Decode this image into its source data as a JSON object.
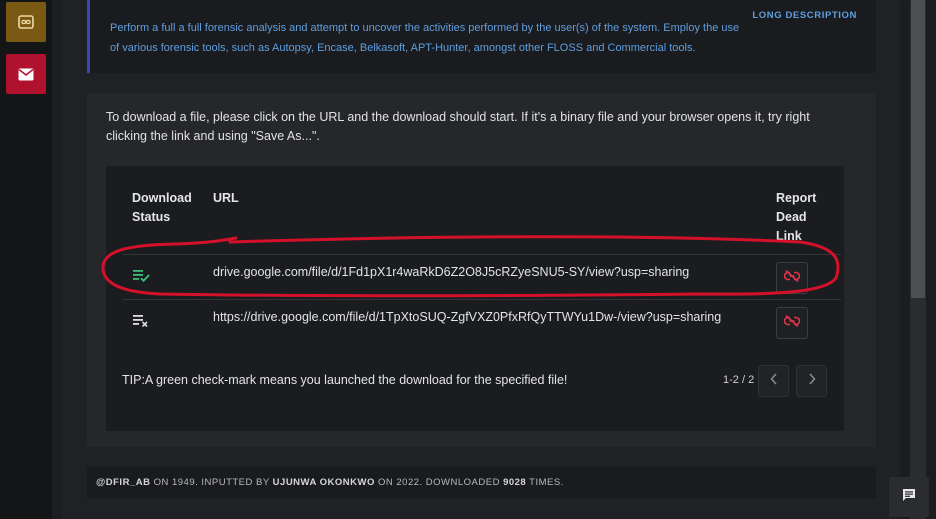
{
  "description": {
    "label": "LONG DESCRIPTION",
    "text": "Perform a full a full forensic analysis and attempt to uncover the activities performed by the user(s) of the system. Employ the use of various forensic tools, such as Autopsy, Encase, Belkasoft, APT-Hunter, amongst other FLOSS and Commercial tools."
  },
  "downloads": {
    "intro": "To download a file, please click on the URL and the download should start. If it's a binary file and your browser opens it, try right clicking the link and using \"Save As...\".",
    "headers": {
      "status_line1": "Download",
      "status_line2": "Status",
      "url": "URL",
      "report_line1": "Report",
      "report_line2": "Dead",
      "report_line3": "Link"
    },
    "rows": [
      {
        "status": "downloaded",
        "status_icon": "playlist-check-icon",
        "url": "drive.google.com/file/d/1Fd1pX1r4waRkD6Z2O8J5cRZyeSNU5-SY/view?usp=sharing"
      },
      {
        "status": "not-downloaded",
        "status_icon": "playlist-remove-icon",
        "url": "https://drive.google.com/file/d/1TpXtoSUQ-ZgfVXZ0PfxRfQyTTWYu1Dw-/view?usp=sharing"
      }
    ],
    "tip": "TIP:A green check-mark means you launched the download for the specified file!",
    "pager": "1-2 / 2"
  },
  "footer": {
    "author": "@DFIR_AB",
    "on1": " ON 1949. INPUTTED BY ",
    "inputter": "UJUNWA OKONKWO",
    "on2": " ON 2022. DOWNLOADED ",
    "downloads": "9028",
    "times": " TIMES."
  },
  "colors": {
    "accent_blue": "#5f9fe0",
    "check_green": "#3bbf7a",
    "dead_link_red": "#e0344a",
    "annotation_red": "#d4102a"
  }
}
